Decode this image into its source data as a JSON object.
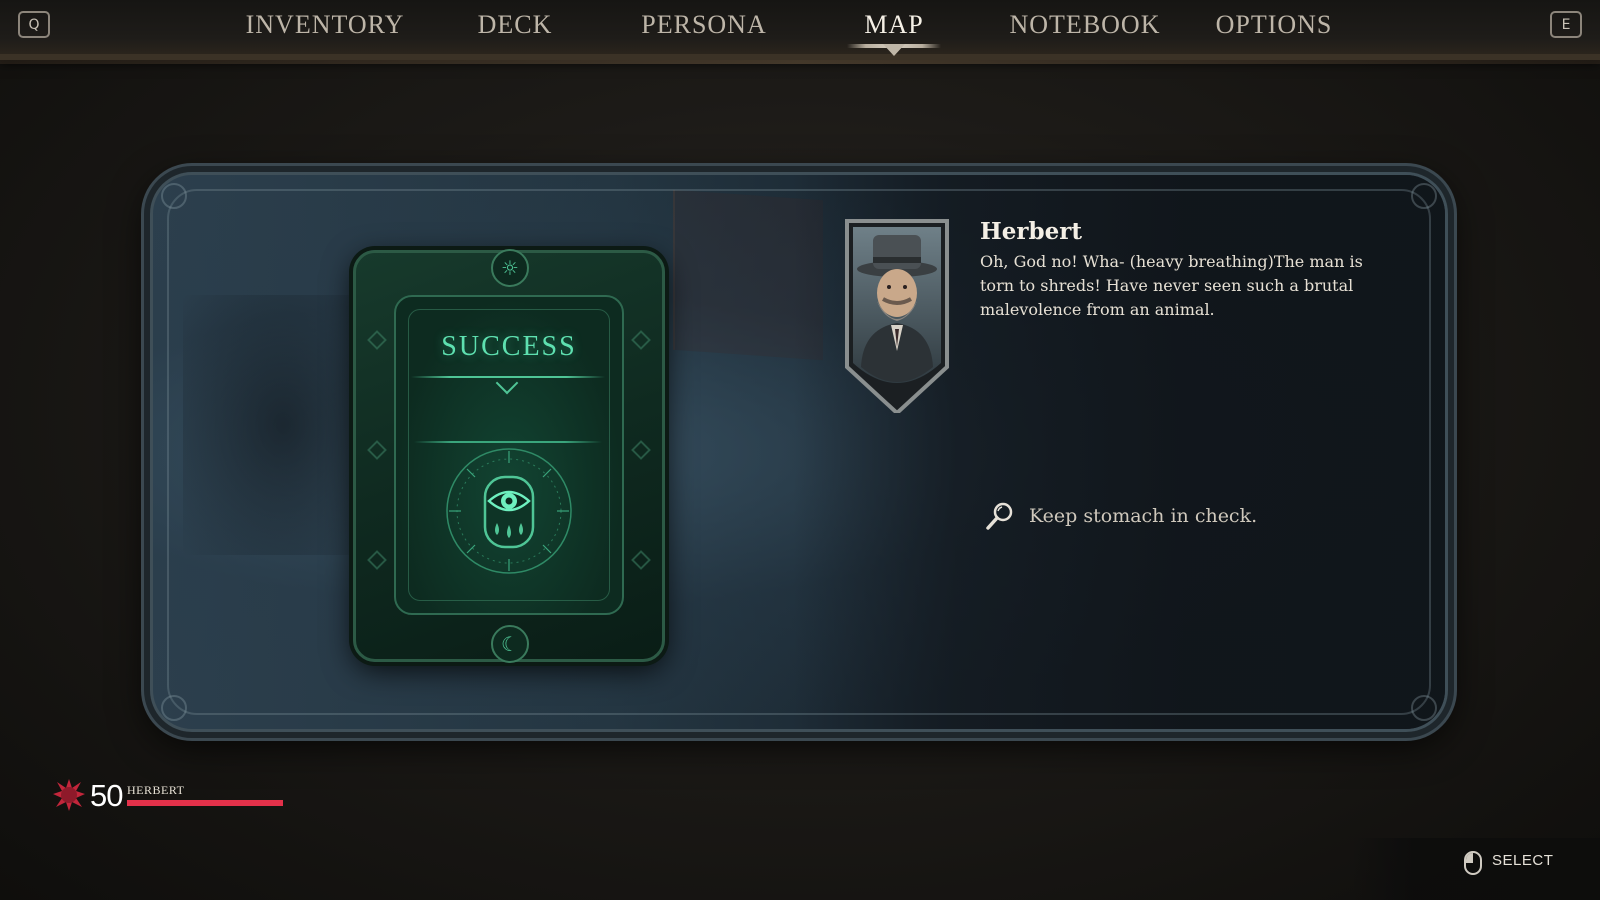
{
  "nav": {
    "key_left": "Q",
    "key_right": "E",
    "tabs": [
      {
        "label": "INVENTORY"
      },
      {
        "label": "DECK"
      },
      {
        "label": "PERSONA"
      },
      {
        "label": "MAP",
        "active": true
      },
      {
        "label": "NOTEBOOK"
      },
      {
        "label": "OPTIONS"
      }
    ]
  },
  "card": {
    "title": "SUCCESS",
    "sigil_icon": "eye-tears-icon",
    "accent_color": "#5ee0b0"
  },
  "dialogue": {
    "speaker": "Herbert",
    "text": "Oh, God no! Wha- (heavy breathing)The man is torn to shreds! Have never seen such a brutal malevolence from an animal.",
    "check_icon": "magnifier-icon",
    "check_text": "Keep stomach in check."
  },
  "hud": {
    "value": "50",
    "name": "HERBERT",
    "bar_fraction": 1.0,
    "bar_color": "#e3314a"
  },
  "controls": {
    "select_label": "SELECT",
    "select_icon": "mouse-icon"
  }
}
